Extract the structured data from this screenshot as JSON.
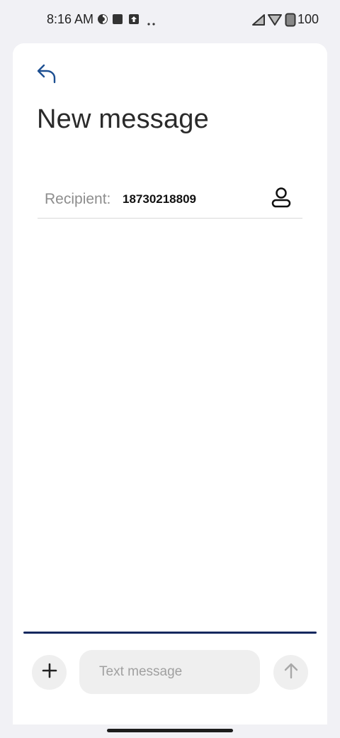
{
  "status_bar": {
    "time": "8:16 AM",
    "battery": "100",
    "icons": [
      "data-saver-icon",
      "stop-icon",
      "upload-icon",
      "more-dots-icon",
      "signal-icon",
      "wifi-icon",
      "battery-icon"
    ]
  },
  "header": {
    "back_icon": "reply-back-icon",
    "title": "New message"
  },
  "recipient": {
    "label": "Recipient:",
    "value": "18730218809",
    "contact_icon": "contact-person-icon"
  },
  "composer": {
    "placeholder": "Text message",
    "value": "",
    "add_icon": "plus-icon",
    "send_icon": "arrow-up-icon"
  },
  "colors": {
    "accent": "#14285e",
    "back_icon": "#1d4f91",
    "surface": "#ffffff",
    "background": "#f1f1f5"
  }
}
